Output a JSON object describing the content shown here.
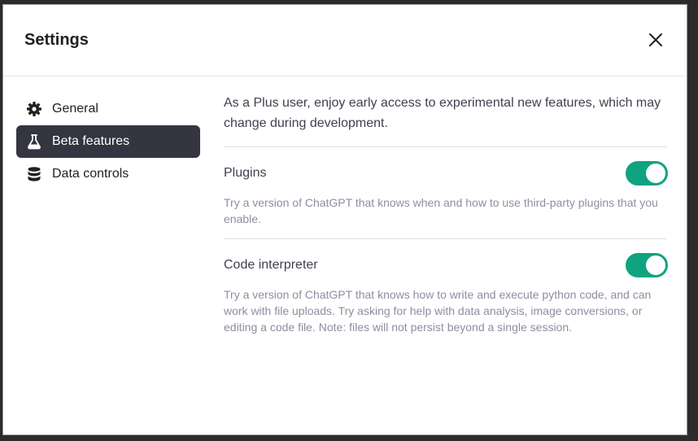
{
  "modal": {
    "title": "Settings"
  },
  "sidebar": {
    "items": [
      {
        "label": "General",
        "icon": "gear-icon"
      },
      {
        "label": "Beta features",
        "icon": "flask-icon",
        "active": true
      },
      {
        "label": "Data controls",
        "icon": "database-icon"
      }
    ]
  },
  "content": {
    "intro": "As a Plus user, enjoy early access to experimental new features, which may change during development.",
    "features": [
      {
        "name": "Plugins",
        "enabled": true,
        "description": "Try a version of ChatGPT that knows when and how to use third-party plugins that you enable."
      },
      {
        "name": "Code interpreter",
        "enabled": true,
        "description": "Try a version of ChatGPT that knows how to write and execute python code, and can work with file uploads. Try asking for help with data analysis, image conversions, or editing a code file. Note: files will not persist beyond a single session."
      }
    ]
  },
  "colors": {
    "toggle_on": "#10a37f",
    "active_nav_bg": "#343541"
  }
}
